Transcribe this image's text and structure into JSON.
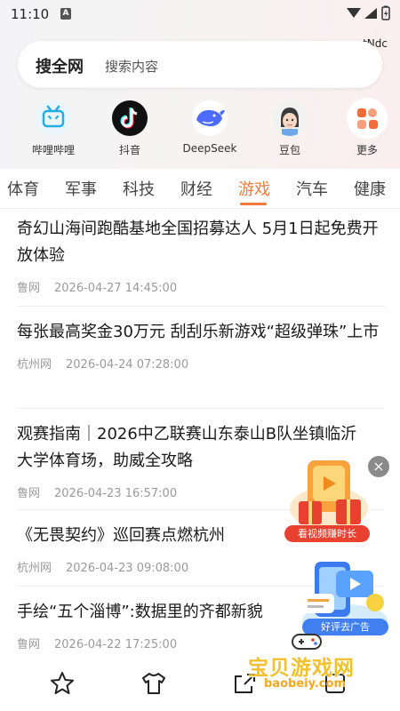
{
  "status_bar": {
    "time": "11:10",
    "notification_icon": "A",
    "net_label": "tNdc"
  },
  "search": {
    "brand": "搜全网",
    "placeholder": "搜索内容"
  },
  "apps": [
    {
      "label": "哔哩哔哩",
      "icon": "bilibili-icon"
    },
    {
      "label": "抖音",
      "icon": "douyin-icon"
    },
    {
      "label": "DeepSeek",
      "icon": "deepseek-icon"
    },
    {
      "label": "豆包",
      "icon": "doubao-icon"
    },
    {
      "label": "更多",
      "icon": "more-apps-icon"
    }
  ],
  "tabs": [
    {
      "label": "体育",
      "active": false
    },
    {
      "label": "军事",
      "active": false
    },
    {
      "label": "科技",
      "active": false
    },
    {
      "label": "财经",
      "active": false
    },
    {
      "label": "游戏",
      "active": true
    },
    {
      "label": "汽车",
      "active": false
    },
    {
      "label": "健康",
      "active": false
    }
  ],
  "news": [
    {
      "title": "奇幻山海间跑酷基地全国招募达人 5月1日起免费开放体验",
      "source": "鲁网",
      "time": "2026-04-27 14:45:00"
    },
    {
      "title": "每张最高奖金30万元 刮刮乐新游戏“超级弹珠”上市",
      "source": "杭州网",
      "time": "2026-04-24 07:28:00"
    },
    {
      "title": "观赛指南｜2026中乙联赛山东泰山B队坐镇临沂大学体育场，助威全攻略",
      "source": "鲁网",
      "time": "2026-04-23 16:57:00"
    },
    {
      "title": "《无畏契约》巡回赛点燃杭州",
      "source": "杭州网",
      "time": "2026-04-23 09:08:00"
    },
    {
      "title": "手绘“五个淄博”:数据里的齐都新貌",
      "source": "鲁网",
      "time": "2026-04-22 17:25:00"
    }
  ],
  "floating": {
    "close": "×",
    "video_reward_label": "看视频赚时长",
    "remove_ads_label": "好评去广告"
  },
  "watermark": {
    "text": "宝贝游戏网",
    "url": "baobeiy.com"
  },
  "colors": {
    "accent": "#ef7a3a",
    "bilibili": "#23ade5",
    "douyin": "#111111",
    "deepseek": "#4d6bfe",
    "more": "#f26b3a"
  }
}
